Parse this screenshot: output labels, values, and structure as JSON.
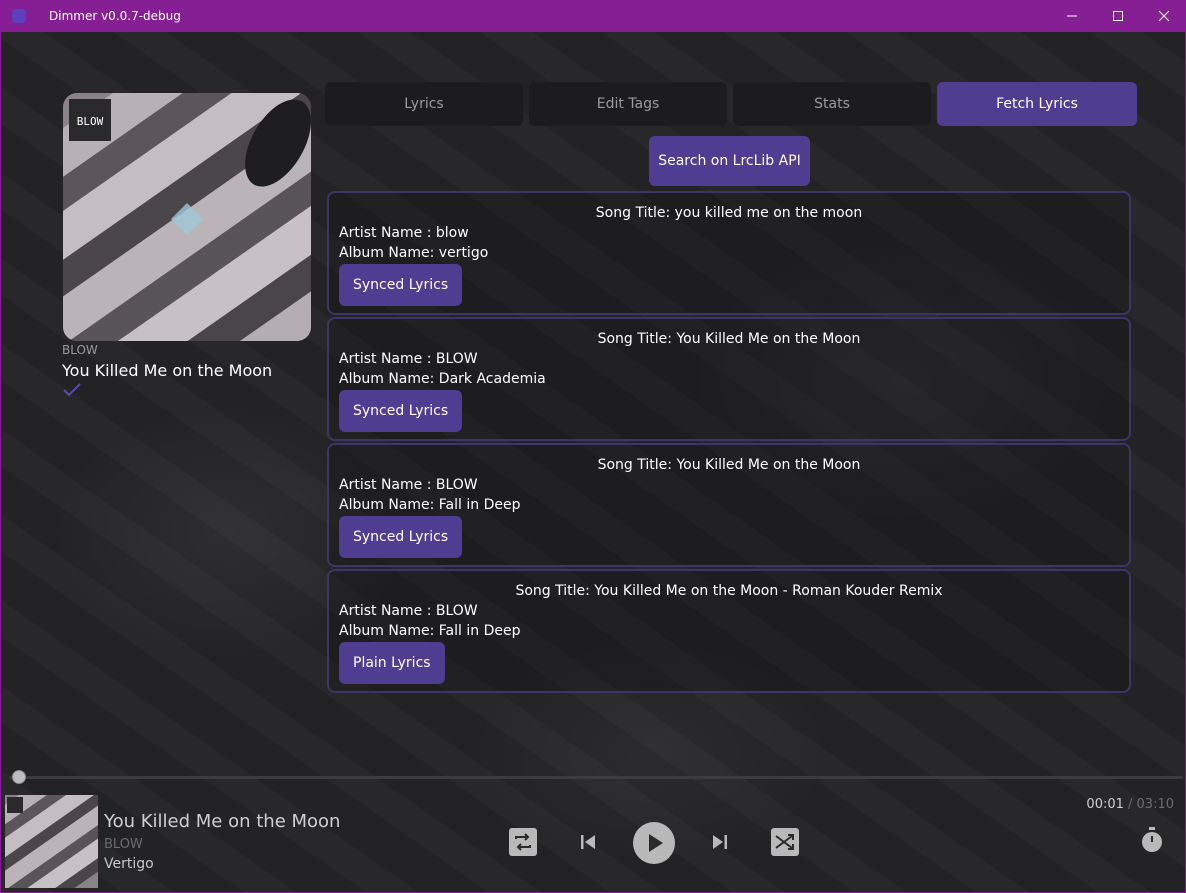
{
  "window": {
    "title": "Dimmer v0.0.7-debug",
    "accent": "#861f93"
  },
  "album_panel": {
    "artist": "BLOW",
    "title": "You Killed Me on the Moon",
    "art_logo_text": "BLOW"
  },
  "tabs": [
    {
      "label": "Lyrics",
      "active": false
    },
    {
      "label": "Edit Tags",
      "active": false
    },
    {
      "label": "Stats",
      "active": false
    },
    {
      "label": "Fetch Lyrics",
      "active": true
    }
  ],
  "search_button": "Search on LrcLib API",
  "results": [
    {
      "title": "Song Title: you killed me on the moon",
      "artist": "Artist Name : blow",
      "album": "Album Name: vertigo",
      "button": "Synced Lyrics"
    },
    {
      "title": "Song Title: You Killed Me on the Moon",
      "artist": "Artist Name : BLOW",
      "album": "Album Name: Dark Academia",
      "button": "Synced Lyrics"
    },
    {
      "title": "Song Title: You Killed Me on the Moon",
      "artist": "Artist Name : BLOW",
      "album": "Album Name: Fall in Deep",
      "button": "Synced Lyrics"
    },
    {
      "title": "Song Title: You Killed Me on the Moon - Roman Kouder Remix",
      "artist": "Artist Name : BLOW",
      "album": "Album Name: Fall in Deep",
      "button": "Plain Lyrics"
    }
  ],
  "player": {
    "title": "You Killed Me on the Moon",
    "artist": "BLOW",
    "album": "Vertigo",
    "current_time": "00:01",
    "total_time": " / 03:10",
    "progress": 0.005
  },
  "colors": {
    "accent_button": "#4e3d91",
    "card_border": "#3d3468"
  }
}
